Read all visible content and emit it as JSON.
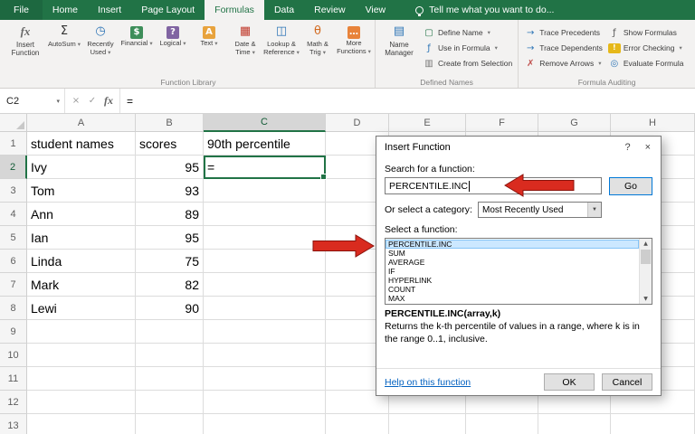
{
  "colors": {
    "excel-green": "#217346",
    "arrow-red": "#d92b1f",
    "link-blue": "#0563c1",
    "list-selection": "#cce8ff"
  },
  "app": {
    "tabs": [
      "File",
      "Home",
      "Insert",
      "Page Layout",
      "Formulas",
      "Data",
      "Review",
      "View"
    ],
    "active_tab": "Formulas",
    "tell_me": "Tell me what you want to do..."
  },
  "ribbon": {
    "function_library": {
      "label": "Function Library",
      "buttons": [
        {
          "name": "insert-function",
          "label": "Insert Function",
          "glyph": "fx",
          "fg": "#6a6a6a",
          "serif": true,
          "wide": true
        },
        {
          "name": "autosum",
          "label": "AutoSum",
          "glyph": "Σ",
          "fg": "#333333",
          "arrow": true
        },
        {
          "name": "recently-used",
          "label": "Recently Used",
          "glyph": "◷",
          "fg": "#2e75b6",
          "arrow": true
        },
        {
          "name": "financial",
          "label": "Financial",
          "glyph": "$",
          "fg": "#ffffff",
          "bg": "#3e8e5a",
          "arrow": true
        },
        {
          "name": "logical",
          "label": "Logical",
          "glyph": "?",
          "fg": "#ffffff",
          "bg": "#8064a2",
          "arrow": true
        },
        {
          "name": "text",
          "label": "Text",
          "glyph": "A",
          "fg": "#ffffff",
          "bg": "#e8a33d",
          "arrow": true
        },
        {
          "name": "date-time",
          "label": "Date & Time",
          "glyph": "▦",
          "fg": "#c0392b",
          "arrow": true
        },
        {
          "name": "lookup-reference",
          "label": "Lookup & Reference",
          "glyph": "◫",
          "fg": "#2e75b6",
          "arrow": true
        },
        {
          "name": "math-trig",
          "label": "Math & Trig",
          "glyph": "θ",
          "fg": "#d2691e",
          "arrow": true
        },
        {
          "name": "more-functions",
          "label": "More Functions",
          "glyph": "…",
          "fg": "#ffffff",
          "bg": "#e8833a",
          "arrow": true
        }
      ]
    },
    "defined_names": {
      "label": "Defined Names",
      "name_manager": {
        "name": "name-manager",
        "label": "Name Manager",
        "glyph": "▤",
        "fg": "#2e75b6"
      },
      "items": [
        {
          "name": "define-name",
          "label": "Define Name",
          "glyph": "▢",
          "fg": "#217346",
          "arrow": true
        },
        {
          "name": "use-in-formula",
          "label": "Use in Formula",
          "glyph": "ƒ",
          "fg": "#2e75b6",
          "arrow": true
        },
        {
          "name": "create-from-selection",
          "label": "Create from Selection",
          "glyph": "▥",
          "fg": "#777777"
        }
      ]
    },
    "formula_auditing": {
      "label": "Formula Auditing",
      "col1": [
        {
          "name": "trace-precedents",
          "label": "Trace Precedents",
          "glyph": "→",
          "fg": "#2e75b6"
        },
        {
          "name": "trace-dependents",
          "label": "Trace Dependents",
          "glyph": "→",
          "fg": "#2e75b6"
        },
        {
          "name": "remove-arrows",
          "label": "Remove Arrows",
          "glyph": "✗",
          "fg": "#c0504d",
          "arrow": true
        }
      ],
      "col2": [
        {
          "name": "show-formulas",
          "label": "Show Formulas",
          "glyph": "ƒ",
          "fg": "#555555"
        },
        {
          "name": "error-checking",
          "label": "Error Checking",
          "glyph": "!",
          "fg": "#ffffff",
          "bg": "#e6b819",
          "arrow": true
        },
        {
          "name": "evaluate-formula",
          "label": "Evaluate Formula",
          "glyph": "◎",
          "fg": "#2e75b6"
        }
      ]
    }
  },
  "formula_bar": {
    "name_box": "C2",
    "dropdown_icon": "▾",
    "cancel_icon": "×",
    "enter_icon": "✓",
    "fx_icon": "fx",
    "formula": "="
  },
  "sheet": {
    "col_headers": [
      "A",
      "B",
      "C",
      "D",
      "E",
      "F",
      "G",
      "H"
    ],
    "row_headers": [
      "1",
      "2",
      "3",
      "4",
      "5",
      "6",
      "7",
      "8",
      "9",
      "10",
      "11",
      "12",
      "13"
    ],
    "selection": {
      "col": "C",
      "row": 2
    },
    "cells": [
      [
        "student names",
        "scores",
        "90th percentile",
        "",
        "",
        "",
        "",
        ""
      ],
      [
        "Ivy",
        "95",
        "=",
        "",
        "",
        "",
        "",
        ""
      ],
      [
        "Tom",
        "93",
        "",
        "",
        "",
        "",
        "",
        ""
      ],
      [
        "Ann",
        "89",
        "",
        "",
        "",
        "",
        "",
        ""
      ],
      [
        "Ian",
        "95",
        "",
        "",
        "",
        "",
        "",
        ""
      ],
      [
        "Linda",
        "75",
        "",
        "",
        "",
        "",
        "",
        ""
      ],
      [
        "Mark",
        "82",
        "",
        "",
        "",
        "",
        "",
        ""
      ],
      [
        "Lewi",
        "90",
        "",
        "",
        "",
        "",
        "",
        ""
      ]
    ]
  },
  "dialog": {
    "title": "Insert Function",
    "help_icon": "?",
    "close_icon": "×",
    "search_label": "Search for a function:",
    "search_value": "PERCENTILE.INC",
    "go_label": "Go",
    "category_label": "Or select a category:",
    "category_value": "Most Recently Used",
    "select_label": "Select a function:",
    "functions": [
      "PERCENTILE.INC",
      "SUM",
      "AVERAGE",
      "IF",
      "HYPERLINK",
      "COUNT",
      "MAX"
    ],
    "selected_function": "PERCENTILE.INC",
    "signature": "PERCENTILE.INC(array,k)",
    "description": "Returns the k-th percentile of values in a range, where k is in the range 0..1, inclusive.",
    "help_link": "Help on this function",
    "ok_label": "OK",
    "cancel_label": "Cancel"
  }
}
